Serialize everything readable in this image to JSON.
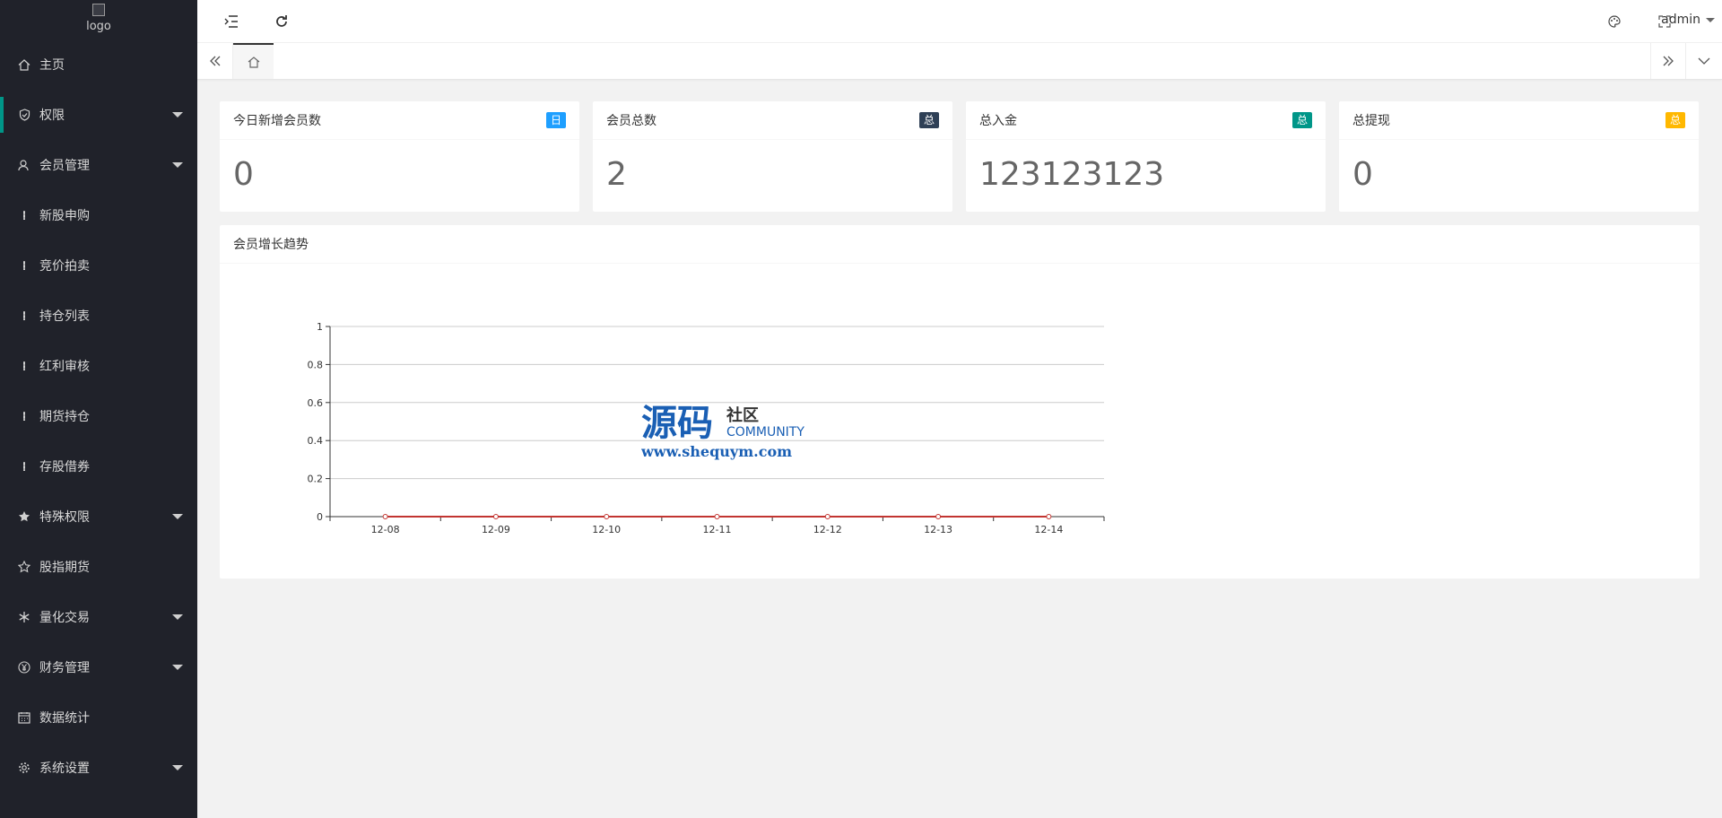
{
  "logo": {
    "alt": "logo"
  },
  "sidebar": {
    "items": [
      {
        "label": "主页",
        "icon": "home-icon",
        "has_caret": false,
        "active": false
      },
      {
        "label": "权限",
        "icon": "shield-check-icon",
        "has_caret": true,
        "active": true
      },
      {
        "label": "会员管理",
        "icon": "user-icon",
        "has_caret": true,
        "active": false
      },
      {
        "label": "新股申购",
        "icon": "more-vertical-icon",
        "has_caret": false,
        "active": false
      },
      {
        "label": "竞价拍卖",
        "icon": "more-vertical-icon",
        "has_caret": false,
        "active": false
      },
      {
        "label": "持仓列表",
        "icon": "more-vertical-icon",
        "has_caret": false,
        "active": false
      },
      {
        "label": "红利审核",
        "icon": "more-vertical-icon",
        "has_caret": false,
        "active": false
      },
      {
        "label": "期货持仓",
        "icon": "more-vertical-icon",
        "has_caret": false,
        "active": false
      },
      {
        "label": "存股借券",
        "icon": "more-vertical-icon",
        "has_caret": false,
        "active": false
      },
      {
        "label": "特殊权限",
        "icon": "star-filled-icon",
        "has_caret": true,
        "active": false
      },
      {
        "label": "股指期货",
        "icon": "star-icon",
        "has_caret": false,
        "active": false
      },
      {
        "label": "量化交易",
        "icon": "snowflake-icon",
        "has_caret": true,
        "active": false
      },
      {
        "label": "财务管理",
        "icon": "yen-icon",
        "has_caret": true,
        "active": false
      },
      {
        "label": "数据统计",
        "icon": "calendar-icon",
        "has_caret": false,
        "active": false
      },
      {
        "label": "系统设置",
        "icon": "gear-icon",
        "has_caret": true,
        "active": false
      }
    ]
  },
  "header": {
    "user": "admin"
  },
  "cards": [
    {
      "title": "今日新增会员数",
      "badge": "日",
      "badge_color": "#1e9fff",
      "value": "0"
    },
    {
      "title": "会员总数",
      "badge": "总",
      "badge_color": "#2f4056",
      "value": "2"
    },
    {
      "title": "总入金",
      "badge": "总",
      "badge_color": "#009688",
      "value": "123123123"
    },
    {
      "title": "总提现",
      "badge": "总",
      "badge_color": "#ffb800",
      "value": "0"
    }
  ],
  "chart_panel": {
    "title": "会员增长趋势"
  },
  "watermark": {
    "brand": "源码",
    "brand2": "社区",
    "community": "COMMUNITY",
    "url": "www.shequym.com"
  },
  "chart_data": {
    "type": "line",
    "categories": [
      "12-08",
      "12-09",
      "12-10",
      "12-11",
      "12-12",
      "12-13",
      "12-14"
    ],
    "series": [
      {
        "values": [
          0,
          0,
          0,
          0,
          0,
          0,
          0
        ],
        "color": "#c23531"
      }
    ],
    "ylim": [
      0,
      1
    ],
    "yticks": [
      0,
      0.2,
      0.4,
      0.6,
      0.8,
      1
    ],
    "grid": true
  }
}
